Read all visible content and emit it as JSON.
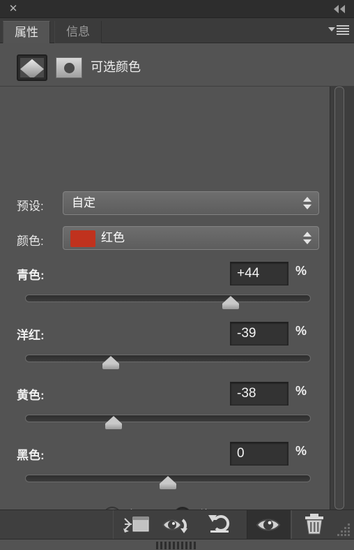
{
  "titlebar": {
    "close_label": "✕",
    "collapse_icon": "double-chevron-left"
  },
  "tabs": [
    {
      "label": "属性",
      "active": true
    },
    {
      "label": "信息",
      "active": false
    }
  ],
  "panel_menu": {
    "icon": "hamburger-menu"
  },
  "layer_header": {
    "adjustment_thumb": "selective-color-adjustment-thumbnail",
    "mask_thumb": "layer-mask-thumbnail",
    "title": "可选颜色"
  },
  "preset": {
    "label": "预设:",
    "value": "自定"
  },
  "color": {
    "label": "颜色:",
    "value": "红色",
    "swatch_hex": "#c0321e"
  },
  "unit": "%",
  "sliders": [
    {
      "name": "cyan",
      "label": "青色:",
      "value": "+44",
      "percent": 72
    },
    {
      "name": "magenta",
      "label": "洋红:",
      "value": "-39",
      "percent": 30
    },
    {
      "name": "yellow",
      "label": "黄色:",
      "value": "-38",
      "percent": 31
    },
    {
      "name": "black",
      "label": "黑色:",
      "value": "0",
      "percent": 50
    }
  ],
  "method": {
    "relative": {
      "label": "相对",
      "selected": false
    },
    "absolute": {
      "label": "绝对",
      "selected": true
    }
  },
  "toolbar": {
    "buttons": [
      {
        "name": "clip-to-layer-button",
        "icon": "clip-to-layer-icon",
        "active": false
      },
      {
        "name": "view-previous-button",
        "icon": "eye-arrow-icon",
        "active": false
      },
      {
        "name": "reset-button",
        "icon": "reset-arrow-icon",
        "active": false
      },
      {
        "name": "toggle-visibility-button",
        "icon": "eye-icon",
        "active": true
      },
      {
        "name": "delete-button",
        "icon": "trash-icon",
        "active": false
      }
    ]
  },
  "colors": {
    "panel_bg": "#535353",
    "titlebar_bg": "#2d2d2d",
    "toolbar_bg": "#3f3f3f",
    "input_bg": "#333333",
    "text": "#ececec"
  }
}
